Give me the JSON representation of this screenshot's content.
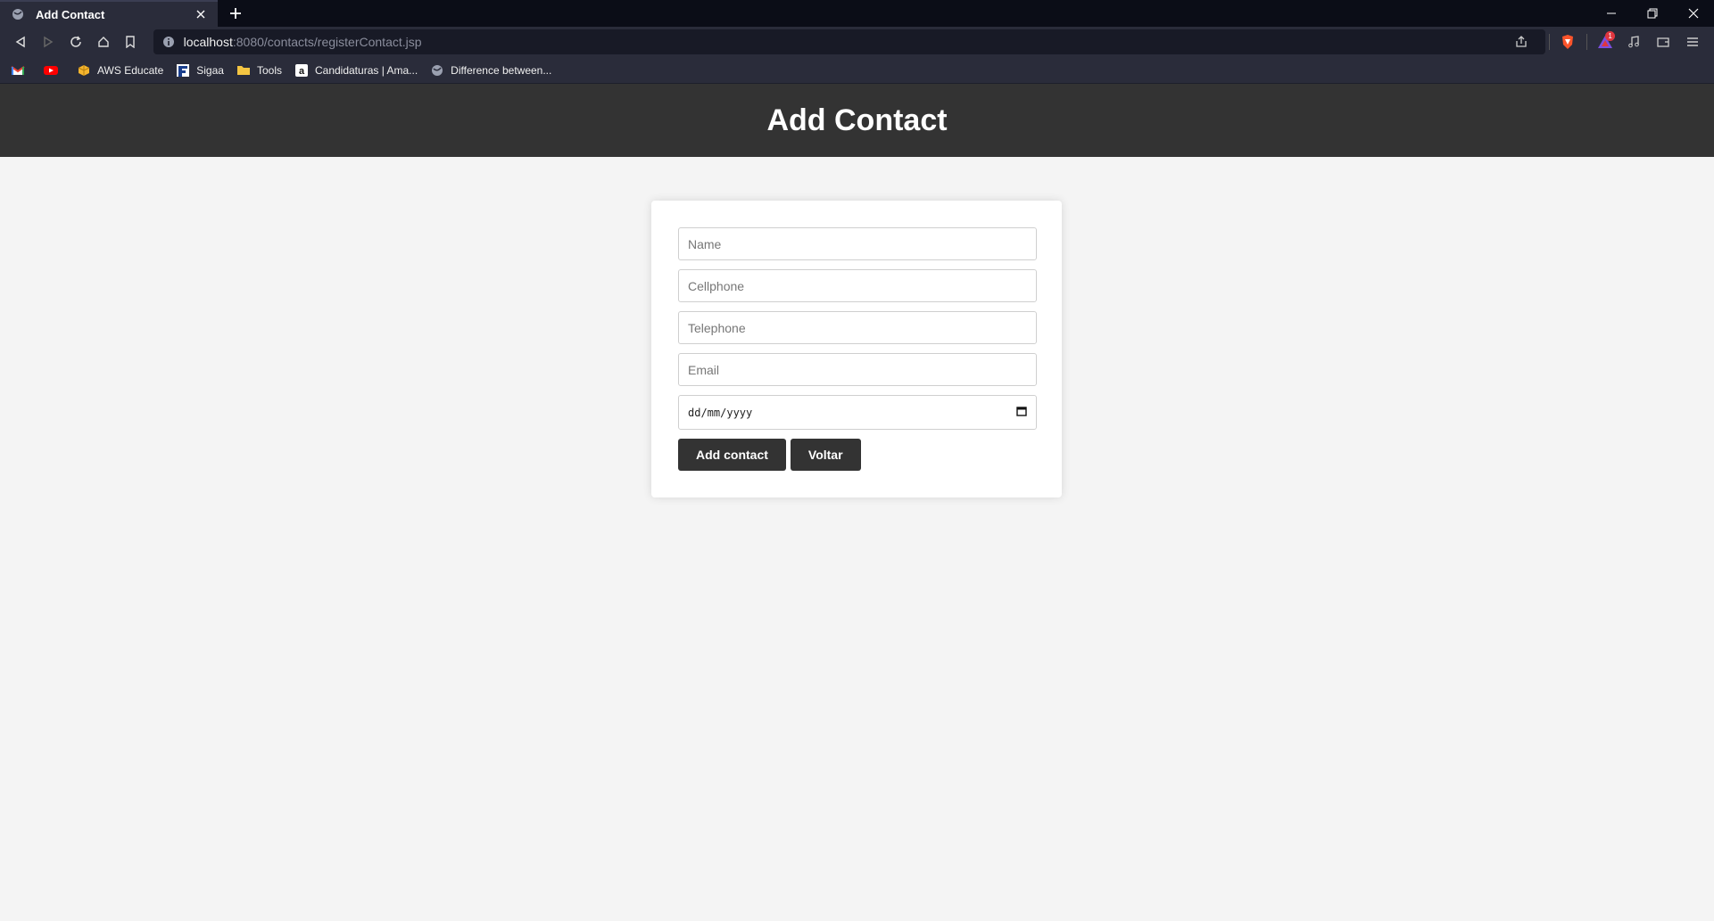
{
  "browser": {
    "tab_title": "Add Contact",
    "url_host": "localhost",
    "url_path": ":8080/contacts/registerContact.jsp",
    "shields_badge": "1",
    "bookmarks": [
      {
        "label": "",
        "icon": "gmail-icon"
      },
      {
        "label": "",
        "icon": "youtube-icon"
      },
      {
        "label": "AWS Educate",
        "icon": "aws-icon"
      },
      {
        "label": "Sigaa",
        "icon": "sigaa-icon"
      },
      {
        "label": "Tools",
        "icon": "folder-icon"
      },
      {
        "label": "Candidaturas | Ama...",
        "icon": "amazon-icon"
      },
      {
        "label": "Difference between...",
        "icon": "globe-icon"
      }
    ]
  },
  "page": {
    "title": "Add Contact"
  },
  "form": {
    "name_placeholder": "Name",
    "cellphone_placeholder": "Cellphone",
    "telephone_placeholder": "Telephone",
    "email_placeholder": "Email",
    "date_placeholder": "dd/mm/yyyy",
    "add_label": "Add contact",
    "back_label": "Voltar"
  },
  "colors": {
    "header_bg": "#333333",
    "page_bg": "#f4f4f4",
    "button_bg": "#333333"
  }
}
